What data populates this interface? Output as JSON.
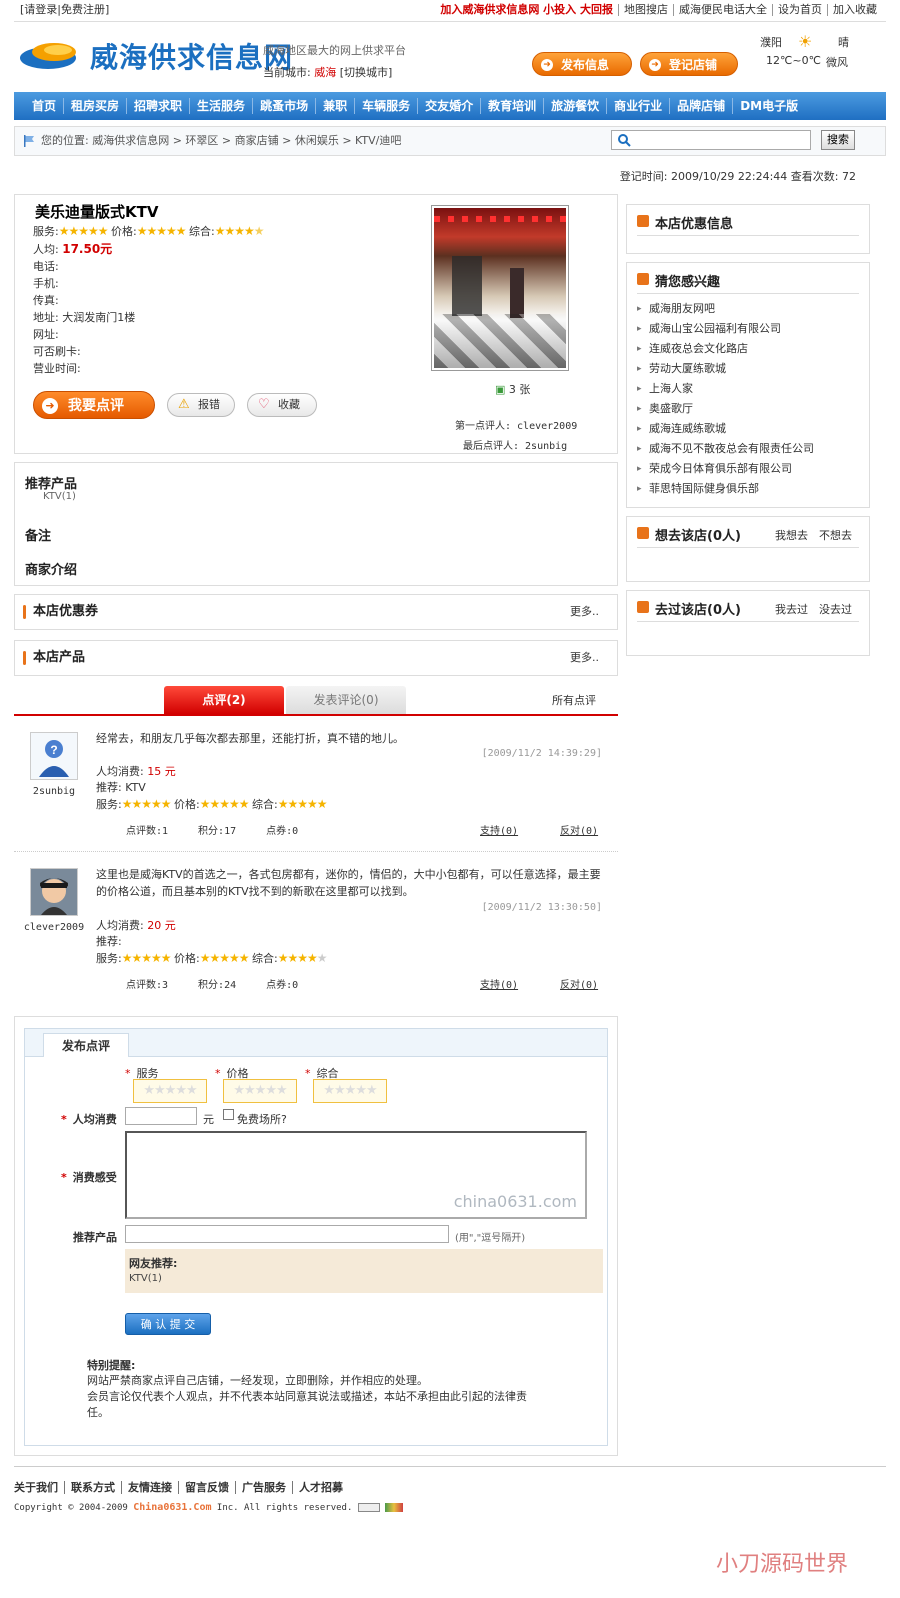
{
  "topbar": {
    "login": "[请登录",
    "register": "|免费注册]",
    "promo": "加入威海供求信息网  小投入  大回报",
    "links": [
      "地图搜店",
      "威海便民电话大全",
      "设为首页",
      "加入收藏"
    ]
  },
  "header": {
    "logo": "威海供求信息网",
    "slogan": "威海地区最大的网上供求平台",
    "city_label": "当前城市:",
    "city": "威海",
    "switch_city": "[切换城市]",
    "publish_btn": "发布信息",
    "register_shop_btn": "登记店铺",
    "weather": {
      "city": "濮阳",
      "cond": "晴",
      "temp": "12℃~0℃",
      "wind": "微风"
    }
  },
  "nav": [
    "首页",
    "租房买房",
    "招聘求职",
    "生活服务",
    "跳蚤市场",
    "兼职",
    "车辆服务",
    "交友婚介",
    "教育培训",
    "旅游餐饮",
    "商业行业",
    "品牌店铺",
    "DM电子版"
  ],
  "breadcrumb": {
    "prefix": "您的位置:",
    "path": "威海供求信息网 > 环翠区 > 商家店铺 > 休闲娱乐 > KTV/迪吧"
  },
  "search": {
    "button": "搜索",
    "placeholder": ""
  },
  "meta": {
    "text": "登记时间: 2009/10/29 22:24:44   查看次数: 72"
  },
  "shop": {
    "name": "美乐迪量版式KTV",
    "rating_service_label": "服务:",
    "rating_price_label": "价格:",
    "rating_overall_label": "综合:",
    "avg_label": "人均:",
    "avg": "17.50元",
    "phone": "电话:",
    "mobile": "手机:",
    "fax": "传真:",
    "address": "地址: 大润发南门1楼",
    "website": "网址:",
    "card": "可否刷卡:",
    "hours": "营业时间:",
    "photo_count": "3 张",
    "first_reviewer": "第一点评人: clever2009",
    "last_reviewer": "最后点评人: 2sunbig",
    "btn_comment": "我要点评",
    "btn_report": "报错",
    "btn_fav": "收藏"
  },
  "details": {
    "recommend_title": "推荐产品",
    "recommend_item": "KTV(1)",
    "note_title": "备注",
    "intro_title": "商家介绍"
  },
  "coupon": {
    "title": "本店优惠券",
    "more": "更多.."
  },
  "products": {
    "title": "本店产品",
    "more": "更多.."
  },
  "tabs": {
    "reviews": "点评(2)",
    "discussion": "发表评论(0)",
    "all": "所有点评"
  },
  "reviews": [
    {
      "user": "2sunbig",
      "text": "经常去，和朋友几乎每次都去那里，还能打折，真不错的地儿。",
      "time": "[2009/11/2 14:39:29]",
      "cost_label": "人均消费:",
      "cost": "15 元",
      "recommend": "推荐: KTV",
      "stats": [
        "点评数:1",
        "积分:17",
        "点券:0"
      ],
      "support": "支持(0)",
      "oppose": "反对(0)"
    },
    {
      "user": "clever2009",
      "text": "这里也是威海KTV的首选之一，各式包房都有，迷你的，情侣的，大中小包都有，可以任意选择，最主要的价格公道，而且基本别的KTV找不到的新歌在这里都可以找到。",
      "time": "[2009/11/2 13:30:50]",
      "cost_label": "人均消费:",
      "cost": "20 元",
      "recommend": "推荐:",
      "stats": [
        "点评数:3",
        "积分:24",
        "点券:0"
      ],
      "support": "支持(0)",
      "oppose": "反对(0)"
    }
  ],
  "form": {
    "tab": "发布点评",
    "r_service": "服务",
    "r_price": "价格",
    "r_overall": "综合",
    "avg_label": "人均消费",
    "yuan": "元",
    "free_label": "免费场所?",
    "feel_label": "消费感受",
    "watermark": "china0631.com",
    "rec_label": "推荐产品",
    "rec_hint": "(用\",\"逗号隔开)",
    "netizen_title": "网友推荐:",
    "netizen_item": "KTV(1)",
    "submit": "确 认 提 交",
    "notice_title": "特别提醒:",
    "notice_1": "网站严禁商家点评自己店铺，一经发现，立即删除，并作相应的处理。",
    "notice_2": "会员言论仅代表个人观点，并不代表本站同意其说法或描述，本站不承担由此引起的法律责任。"
  },
  "sidebar": {
    "offers_title": "本店优惠信息",
    "interest_title": "猜您感兴趣",
    "interest": [
      "威海朋友网吧",
      "威海山宝公园福利有限公司",
      "连威夜总会文化路店",
      "劳动大厦练歌城",
      "上海人家",
      "奥盛歌厅",
      "威海连威练歌城",
      "威海不见不散夜总会有限责任公司",
      "荣成今日体育俱乐部有限公司",
      "菲思特国际健身俱乐部"
    ],
    "want_title": "想去该店(0人)",
    "want_yes": "我想去",
    "want_no": "不想去",
    "been_title": "去过该店(0人)",
    "been_yes": "我去过",
    "been_no": "没去过"
  },
  "footer": {
    "links": [
      "关于我们",
      "联系方式",
      "友情连接",
      "留言反馈",
      "广告服务",
      "人才招募"
    ],
    "copyright": "Copyright © 2004-2009",
    "brand": "China0631.Com",
    "rights": "Inc. All rights reserved."
  },
  "watermark": "小刀源码世界"
}
